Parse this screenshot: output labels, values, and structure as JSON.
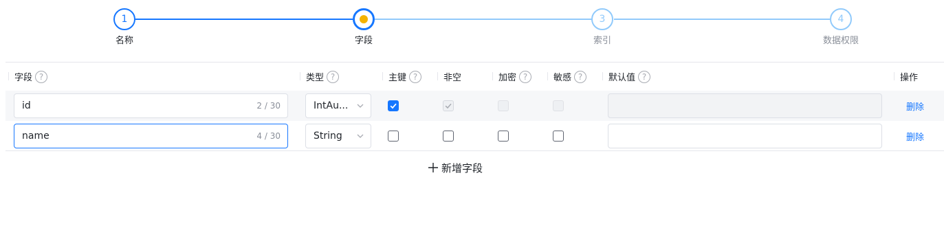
{
  "steps": [
    {
      "number": "1",
      "label": "名称",
      "state": "done"
    },
    {
      "number": "",
      "label": "字段",
      "state": "current"
    },
    {
      "number": "3",
      "label": "索引",
      "state": "pending"
    },
    {
      "number": "4",
      "label": "数据权限",
      "state": "pending"
    }
  ],
  "columns": {
    "field": "字段",
    "type": "类型",
    "primary_key": "主键",
    "not_null": "非空",
    "encrypt": "加密",
    "sensitive": "敏感",
    "default_value": "默认值",
    "actions": "操作",
    "help_symbol": "?"
  },
  "rows": [
    {
      "name": "id",
      "count": "2 / 30",
      "type": "IntAu...",
      "primary_key": "checked",
      "not_null": "checked-disabled",
      "encrypt": "disabled",
      "sensitive": "disabled",
      "default_value": "",
      "default_disabled": true,
      "delete_label": "删除"
    },
    {
      "name": "name",
      "count": "4 / 30",
      "type": "String",
      "primary_key": "unchecked",
      "not_null": "unchecked",
      "encrypt": "unchecked",
      "sensitive": "unchecked",
      "default_value": "",
      "default_disabled": false,
      "delete_label": "删除"
    }
  ],
  "add_field_label": "新增字段",
  "add_field_icon": "plus-icon",
  "colors": {
    "primary": "#1677ff",
    "pending": "#91cafb",
    "current_dot": "#f5b300"
  }
}
